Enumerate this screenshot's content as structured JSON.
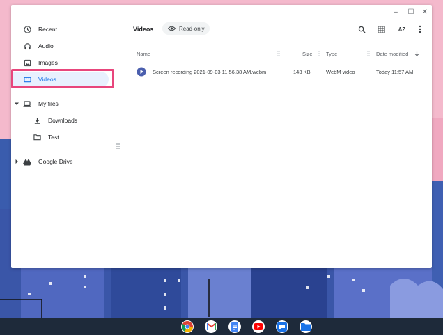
{
  "window": {
    "controls": {
      "minimize": "–",
      "maximize": "☐",
      "close": "✕"
    }
  },
  "sidebar": {
    "items": [
      {
        "label": "Recent",
        "icon": "clock-icon"
      },
      {
        "label": "Audio",
        "icon": "headphones-icon"
      },
      {
        "label": "Images",
        "icon": "image-icon"
      },
      {
        "label": "Videos",
        "icon": "video-icon",
        "selected": true
      },
      {
        "label": "My files",
        "icon": "laptop-icon",
        "expanded": true
      },
      {
        "label": "Downloads",
        "icon": "download-icon"
      },
      {
        "label": "Test",
        "icon": "folder-icon"
      },
      {
        "label": "Google Drive",
        "icon": "drive-icon",
        "expanded": false
      }
    ]
  },
  "toolbar": {
    "title": "Videos",
    "readonly_chip": "Read-only",
    "sort_label": "AZ"
  },
  "columns": {
    "name": "Name",
    "size": "Size",
    "type": "Type",
    "date": "Date modified"
  },
  "files": [
    {
      "name": "Screen recording 2021-09-03 11.56.38 AM.webm",
      "size": "143 KB",
      "type": "WebM video",
      "date": "Today 11:57 AM"
    }
  ],
  "colors": {
    "accent": "#1a73e8",
    "highlight": "#e8467c",
    "selected_bg": "#e8f0fe"
  },
  "shelf": {
    "apps": [
      "chrome-icon",
      "gmail-icon",
      "docs-icon",
      "youtube-icon",
      "messages-icon",
      "files-icon"
    ]
  }
}
